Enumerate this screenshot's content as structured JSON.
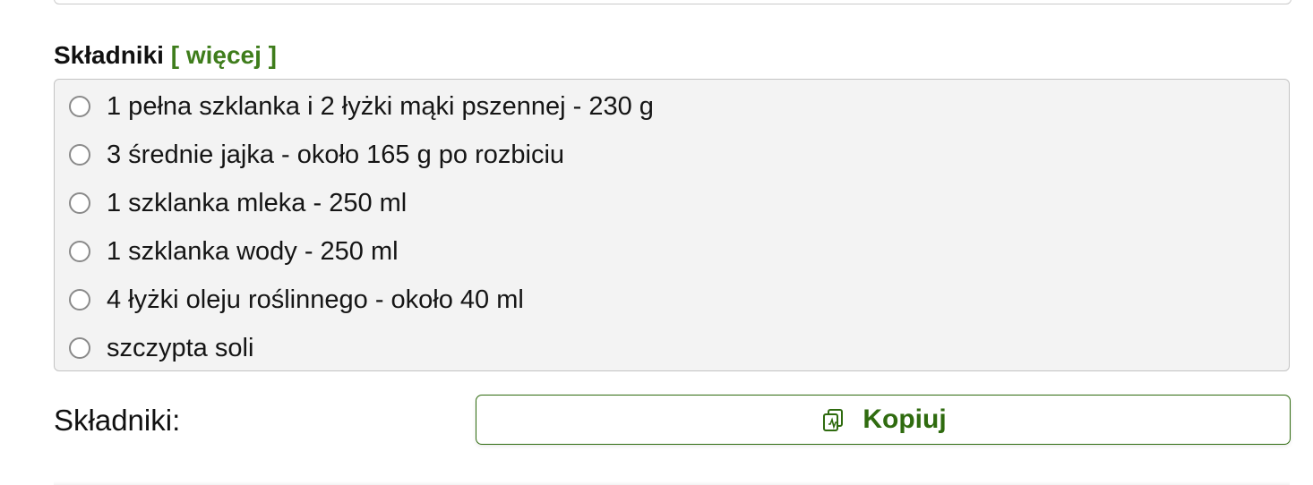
{
  "section": {
    "heading": "Składniki",
    "more_link": "[ więcej ]"
  },
  "ingredients": [
    {
      "label": "1 pełna szklanka i 2 łyżki mąki pszennej - 230 g"
    },
    {
      "label": "3 średnie jajka - około 165 g po rozbiciu"
    },
    {
      "label": "1 szklanka mleka - 250 ml"
    },
    {
      "label": "1 szklanka wody - 250 ml"
    },
    {
      "label": "4 łyżki oleju roślinnego - około 40 ml"
    },
    {
      "label": "szczypta soli"
    }
  ],
  "copy": {
    "label": "Składniki:",
    "button_label": "Kopiuj",
    "icon": "copy-icon"
  },
  "colors": {
    "accent": "#3f7d1c",
    "button_border": "#2f6b0f",
    "list_background": "#f3f3f3"
  }
}
